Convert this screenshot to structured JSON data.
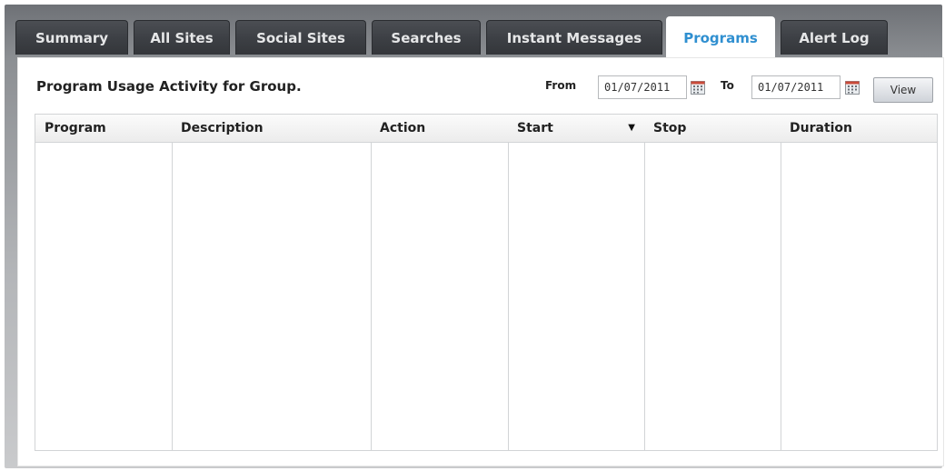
{
  "tabs": [
    {
      "label": "Summary",
      "active": false
    },
    {
      "label": "All Sites",
      "active": false
    },
    {
      "label": "Social Sites",
      "active": false
    },
    {
      "label": "Searches",
      "active": false
    },
    {
      "label": "Instant Messages",
      "active": false
    },
    {
      "label": "Programs",
      "active": true
    },
    {
      "label": "Alert Log",
      "active": false
    }
  ],
  "panel": {
    "title": "Program Usage Activity for Group.",
    "from_label": "From",
    "from_date": "01/07/2011",
    "to_label": "To",
    "to_date": "01/07/2011",
    "view_label": "View"
  },
  "table": {
    "columns": [
      "Program",
      "Description",
      "Action",
      "Start",
      "Stop",
      "Duration"
    ],
    "sorted_column": "Start",
    "sort_direction": "descending",
    "rows": []
  },
  "colors": {
    "active_tab_text": "#2f8fd0",
    "tab_bg": "#3c3f44"
  },
  "icons": {
    "calendar": "calendar-icon",
    "sort": "sort-desc-icon"
  }
}
